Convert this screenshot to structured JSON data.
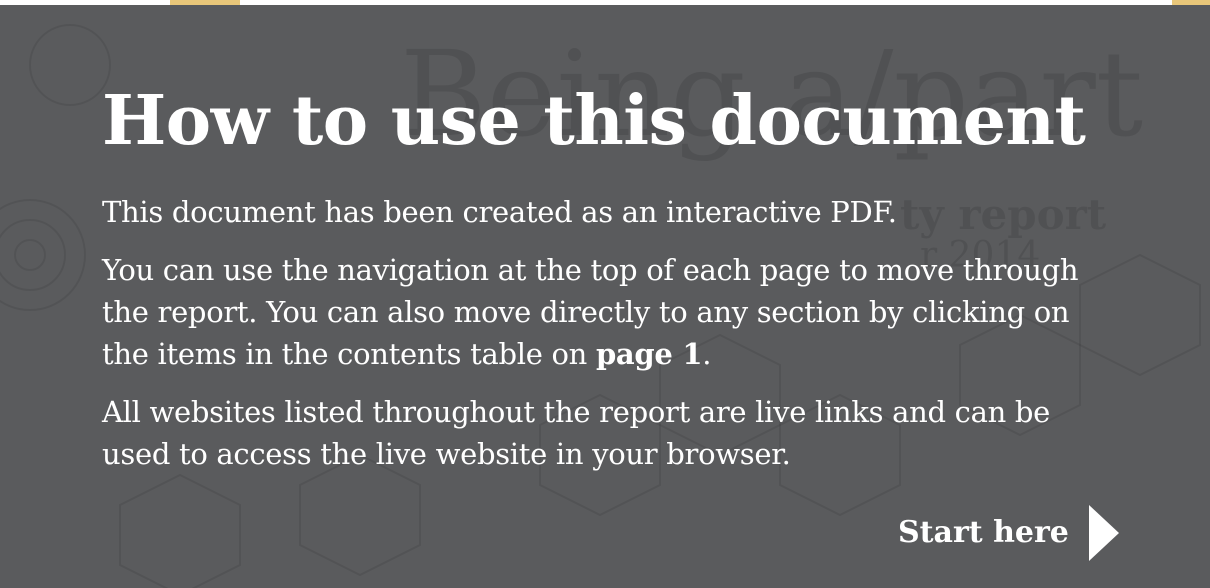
{
  "heading": "How to use this document",
  "paragraphs": {
    "p1": "This document has been created as an interactive PDF.",
    "p2_before": "You can use the navigation at the top of each page to move through the report. You can also move directly to any section by clicking on the items in the contents table on ",
    "p2_bold": "page 1",
    "p2_after": ".",
    "p3": "All websites listed throughout the report are live links and can be used to access the live website in your browser."
  },
  "start": {
    "label": "Start here",
    "icon": "play-arrow-icon"
  },
  "background": {
    "title": "Being a/part",
    "subtitle1": "ty report",
    "subtitle2": "r 2014"
  },
  "colors": {
    "overlay": "#5a5b5d",
    "text": "#ffffff",
    "accent": "#e9c77a"
  }
}
